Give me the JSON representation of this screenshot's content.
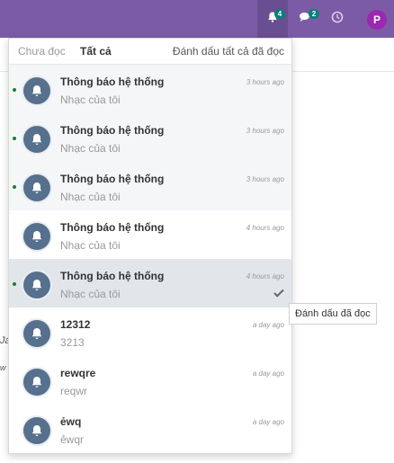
{
  "topbar": {
    "notifications_badge": "4",
    "messages_badge": "2",
    "avatar_letter": "P"
  },
  "background_fragments": [
    "Ja",
    "w"
  ],
  "dropdown": {
    "tabs": {
      "unread": "Chưa đọc",
      "all": "Tất cả"
    },
    "mark_all_label": "Đánh dấu tất cả đã đọc",
    "items": [
      {
        "title": "Thông báo hệ thống",
        "subtitle": "Nhạc của tôi",
        "time": "3 hours ago",
        "unread": true
      },
      {
        "title": "Thông báo hệ thống",
        "subtitle": "Nhạc của tôi",
        "time": "3 hours ago",
        "unread": true
      },
      {
        "title": "Thông báo hệ thống",
        "subtitle": "Nhạc của tôi",
        "time": "3 hours ago",
        "unread": true
      },
      {
        "title": "Thông báo hệ thống",
        "subtitle": "Nhạc của tôi",
        "time": "4 hours ago",
        "unread": false
      },
      {
        "title": "Thông báo hệ thống",
        "subtitle": "Nhạc của tôi",
        "time": "4 hours ago",
        "unread": true
      },
      {
        "title": "12312",
        "subtitle": "3213",
        "time": "a day ago",
        "unread": false
      },
      {
        "title": "rewqre",
        "subtitle": "reqwr",
        "time": "a day ago",
        "unread": false
      },
      {
        "title": "ẻwq",
        "subtitle": "ẻwqr",
        "time": "a day ago",
        "unread": false
      }
    ]
  },
  "tooltip": {
    "text": "Đánh dấu đã đọc"
  },
  "colors": {
    "topbar": "#7b5ba5",
    "badge": "#0a8078",
    "unread_dot": "#1e7e34",
    "bell_bg": "#56708d"
  }
}
